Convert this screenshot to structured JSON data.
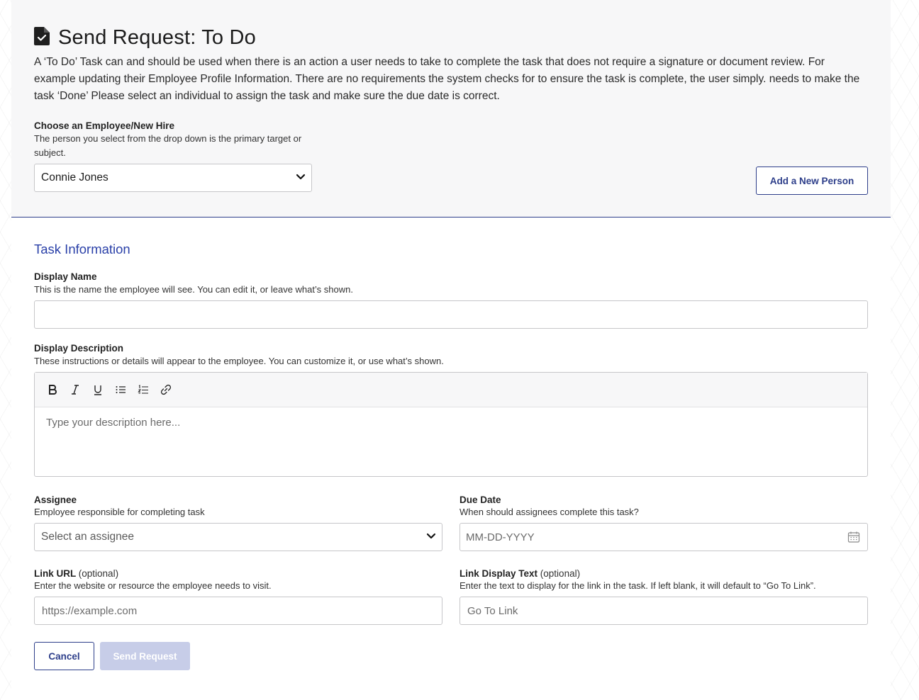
{
  "header": {
    "icon": "document-check-icon",
    "title": "Send Request: To Do",
    "intro": "A ‘To Do’ Task can and should be used when there is an action a user needs to take to complete the task that does not require a signature or document review. For example updating their Employee Profile Information. There are no requirements the system checks for to ensure the task is complete, the user simply. needs to make the task ‘Done’ Please select an individual to assign the task and make sure the due date is correct."
  },
  "employee": {
    "label": "Choose an Employee/New Hire",
    "helper": "The person you select from the drop down is the primary target or subject.",
    "selected": "Connie Jones",
    "add_button": "Add a New Person"
  },
  "task": {
    "section_title": "Task Information",
    "display_name": {
      "label": "Display Name",
      "helper": "This is the name the employee will see. You can edit it, or leave what’s shown.",
      "value": ""
    },
    "display_description": {
      "label": "Display Description",
      "helper": "These instructions or details will appear to the employee. You can customize it, or use what’s shown.",
      "placeholder": "Type your description here...",
      "toolbar": [
        "bold-icon",
        "italic-icon",
        "underline-icon",
        "bullet-list-icon",
        "numbered-list-icon",
        "link-icon"
      ]
    },
    "assignee": {
      "label": "Assignee",
      "helper": "Employee responsible for completing task",
      "placeholder": "Select an assignee"
    },
    "due_date": {
      "label": "Due Date",
      "helper": "When should assignees complete this task?",
      "placeholder": "MM-DD-YYYY"
    },
    "link_url": {
      "label": "Link URL",
      "optional": "(optional)",
      "helper": "Enter the website or resource the employee needs to visit.",
      "placeholder": "https://example.com"
    },
    "link_text": {
      "label": "Link Display Text",
      "optional": "(optional)",
      "helper": "Enter the text to display for the link in the task. If left blank, it will default to “Go To Link”.",
      "placeholder": "Go To Link"
    }
  },
  "actions": {
    "cancel": "Cancel",
    "send": "Send Request"
  },
  "colors": {
    "primary": "#2d3e8a",
    "section_title": "#2a40a8",
    "disabled_button": "#c7cde8"
  }
}
